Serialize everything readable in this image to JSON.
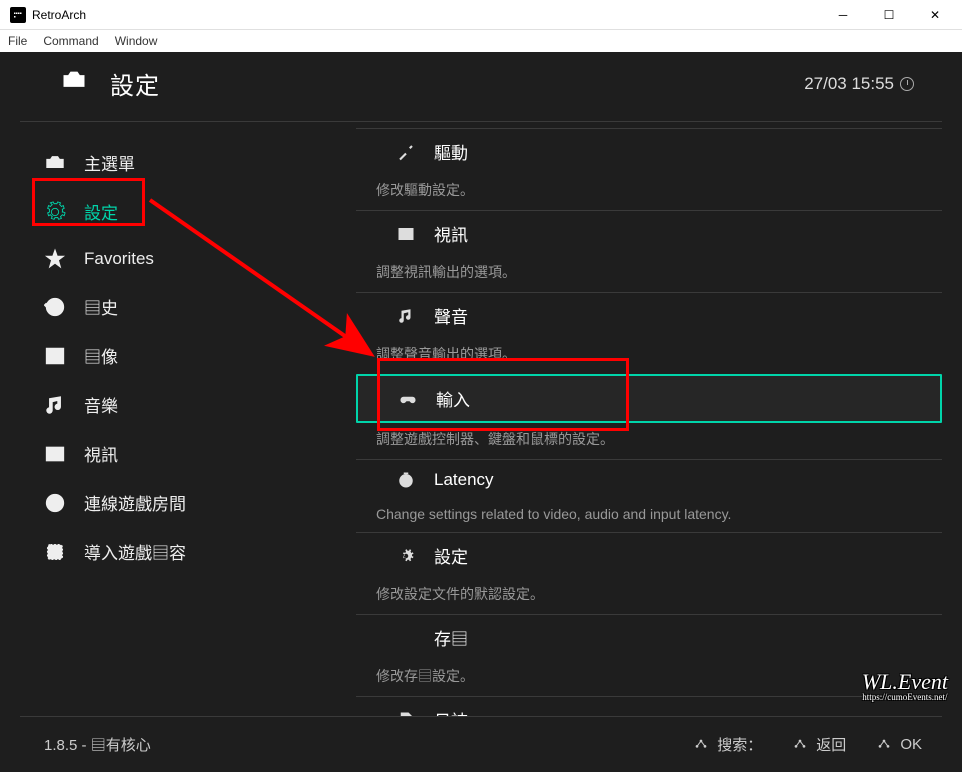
{
  "window": {
    "title": "RetroArch",
    "menus": [
      "File",
      "Command",
      "Window"
    ]
  },
  "header": {
    "title": "設定",
    "datetime": "27/03 15:55"
  },
  "sidebar": {
    "items": [
      {
        "label": "主選單",
        "icon": "retroarch-icon"
      },
      {
        "label": "設定",
        "icon": "gear-icon",
        "active": true
      },
      {
        "label": "Favorites",
        "icon": "star-icon"
      },
      {
        "label": "▤史",
        "icon": "history-icon"
      },
      {
        "label": "▤像",
        "icon": "image-icon"
      },
      {
        "label": "音樂",
        "icon": "music-icon"
      },
      {
        "label": "視訊",
        "icon": "video-icon"
      },
      {
        "label": "連線遊戲房間",
        "icon": "netplay-icon"
      },
      {
        "label": "導入遊戲▤容",
        "icon": "import-icon"
      }
    ]
  },
  "settings": [
    {
      "label": "驅動",
      "desc": "修改驅動設定。",
      "icon": "tools-icon"
    },
    {
      "label": "視訊",
      "desc": "調整視訊輸出的選項。",
      "icon": "video-icon"
    },
    {
      "label": "聲音",
      "desc": "調整聲音輸出的選項。",
      "icon": "music-icon"
    },
    {
      "label": "輸入",
      "desc": "調整遊戲控制器、鍵盤和鼠標的設定。",
      "icon": "controller-icon",
      "highlight": true
    },
    {
      "label": "Latency",
      "desc": "Change settings related to video, audio and input latency.",
      "icon": "latency-icon"
    },
    {
      "label": "設定",
      "desc": "修改設定文件的默認設定。",
      "icon": "gear-icon"
    },
    {
      "label": "存▤",
      "desc": "修改存▤設定。",
      "icon": "save-icon"
    },
    {
      "label": "日誌",
      "desc": "",
      "icon": "log-icon"
    }
  ],
  "footer": {
    "version": "1.8.5 - ▤有核心",
    "actions": [
      {
        "label": "搜索："
      },
      {
        "label": "返回"
      },
      {
        "label": "OK"
      }
    ]
  },
  "watermark": {
    "main": "WL.Event",
    "sub": "https://cumoEvents.net/"
  }
}
